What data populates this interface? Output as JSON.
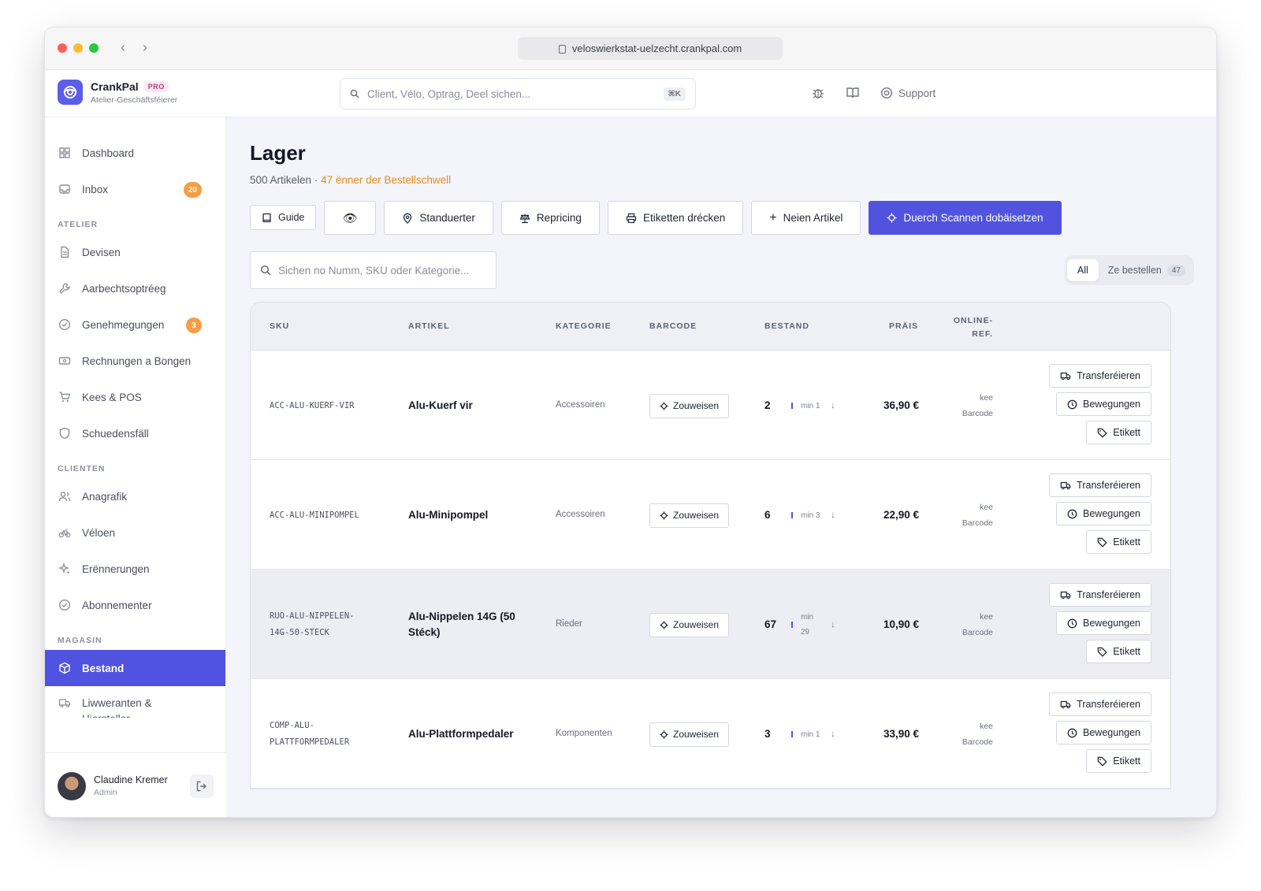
{
  "browser": {
    "url": "veloswierkstat-uelzecht.crankpal.com"
  },
  "brand": {
    "name": "CrankPal",
    "tier": "PRO",
    "subtitle": "Atelier-Geschäftsféierer"
  },
  "search": {
    "placeholder": "Client, Vélo, Optrag, Deel sichen...",
    "shortcut": "⌘K"
  },
  "header_actions": {
    "support": "Support"
  },
  "sidebar": {
    "top": [
      {
        "label": "Dashboard",
        "icon": "grid-icon"
      },
      {
        "label": "Inbox",
        "icon": "inbox-icon",
        "badge": "20"
      }
    ],
    "sections": [
      {
        "title": "ATELIER",
        "items": [
          {
            "label": "Devisen",
            "icon": "document-icon"
          },
          {
            "label": "Aarbechtsoptréeg",
            "icon": "wrench-icon"
          },
          {
            "label": "Genehmegungen",
            "icon": "check-circle-icon",
            "badge": "3"
          },
          {
            "label": "Rechnungen a Bongen",
            "icon": "receipt-icon"
          },
          {
            "label": "Kees & POS",
            "icon": "cart-icon"
          },
          {
            "label": "Schuedensfäll",
            "icon": "shield-icon"
          }
        ]
      },
      {
        "title": "CLIENTEN",
        "items": [
          {
            "label": "Anagrafik",
            "icon": "users-icon"
          },
          {
            "label": "Véloen",
            "icon": "bike-icon"
          },
          {
            "label": "Erënnerungen",
            "icon": "sparkle-icon"
          },
          {
            "label": "Abonnementer",
            "icon": "check-circle-icon"
          }
        ]
      },
      {
        "title": "MAGASIN",
        "items": [
          {
            "label": "Bestand",
            "icon": "box-icon",
            "active": true
          },
          {
            "label": "Liwweranten & Hiersteller",
            "icon": "truck-icon"
          }
        ]
      }
    ],
    "user": {
      "name": "Claudine Kremer",
      "role": "Admin"
    }
  },
  "page": {
    "title": "Lager",
    "subtitle_count": "500 Artikelen",
    "subtitle_sep": " · ",
    "subtitle_warn": "47 ënner der Bestellschwell",
    "toolbar": {
      "guide": "Guide",
      "locations": "Standuerter",
      "repricing": "Repricing",
      "print_labels": "Etiketten drécken",
      "new_item": "Neien Artikel",
      "scan": "Duerch Scannen dobäisetzen"
    },
    "filter_placeholder": "Sichen no Numm, SKU oder Kategorie...",
    "segments": {
      "all": "All",
      "to_order": "Ze bestellen",
      "to_order_count": "47"
    }
  },
  "table": {
    "headers": {
      "sku": "SKU",
      "artikel": "ARTIKEL",
      "kategorie": "KATEGORIE",
      "barcode": "BARCODE",
      "bestand": "BESTAND",
      "praeis": "PRÄIS",
      "online1": "ONLINE-",
      "online2": "REF."
    },
    "labels": {
      "assign": "Zouweisen",
      "transfer": "Transferéieren",
      "moves": "Bewegungen",
      "label": "Etikett",
      "kee": "kee",
      "barcode": "Barcode"
    },
    "rows": [
      {
        "sku1": "ACC-ALU-KUERF-VIR",
        "sku2": "",
        "name1": "Alu-Kuerf vir",
        "name2": "",
        "category": "Accessoiren",
        "stock": "2",
        "min1": "min 1",
        "min2": "",
        "price": "36,90 €"
      },
      {
        "sku1": "ACC-ALU-MINIPOMPEL",
        "sku2": "",
        "name1": "Alu-Minipompel",
        "name2": "",
        "category": "Accessoiren",
        "stock": "6",
        "min1": "min 3",
        "min2": "",
        "price": "22,90 €"
      },
      {
        "sku1": "RUO-ALU-NIPPELEN-",
        "sku2": "14G-50-STECK",
        "name1": "Alu-Nippelen 14G (50",
        "name2": "Stéck)",
        "category": "Rieder",
        "stock": "67",
        "min1": "min",
        "min2": "29",
        "price": "10,90 €"
      },
      {
        "sku1": "COMP-ALU-",
        "sku2": "PLATTFORMPEDALER",
        "name1": "Alu-Plattformpedaler",
        "name2": "",
        "category": "Komponenten",
        "stock": "3",
        "min1": "min 1",
        "min2": "",
        "price": "33,90 €"
      }
    ]
  }
}
